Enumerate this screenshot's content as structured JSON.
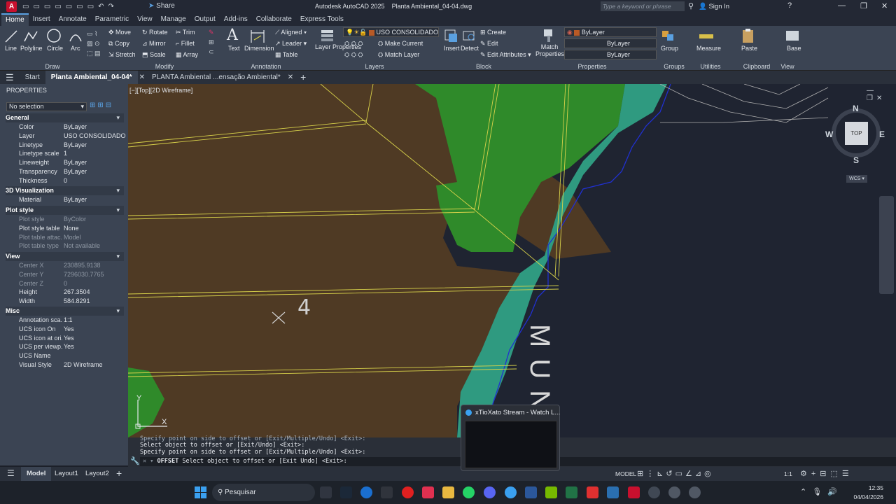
{
  "app": {
    "title": "Autodesk AutoCAD 2025",
    "drawing": "Planta Ambiental_04-04.dwg",
    "share": "Share",
    "search_placeholder": "Type a keyword or phrase",
    "signin": "Sign In"
  },
  "ribbon_tabs": [
    "Home",
    "Insert",
    "Annotate",
    "Parametric",
    "View",
    "Manage",
    "Output",
    "Add-ins",
    "Collaborate",
    "Express Tools"
  ],
  "ribbon": {
    "draw": {
      "line": "Line",
      "polyline": "Polyline",
      "circle": "Circle",
      "arc": "Arc",
      "title": "Draw"
    },
    "modify": {
      "move": "Move",
      "rotate": "Rotate",
      "trim": "Trim",
      "copy": "Copy",
      "mirror": "Mirror",
      "fillet": "Fillet",
      "stretch": "Stretch",
      "scale": "Scale",
      "array": "Array",
      "title": "Modify"
    },
    "annotation": {
      "text": "Text",
      "dimension": "Dimension",
      "aligned": "Aligned",
      "leader": "Leader",
      "table": "Table",
      "title": "Annotation"
    },
    "layers": {
      "layer_properties": "Layer Properties",
      "current_layer": "USO CONSOLIDADO",
      "make_current": "Make Current",
      "match_layer": "Match Layer",
      "title": "Layers"
    },
    "block": {
      "insert": "Insert",
      "detect": "Detect",
      "create": "Create",
      "edit": "Edit",
      "edit_attributes": "Edit Attributes",
      "title": "Block"
    },
    "properties": {
      "match": "Match Properties",
      "color": "ByLayer",
      "linetype": "ByLayer",
      "lineweight": "ByLayer",
      "title": "Properties"
    },
    "groups": {
      "group": "Group",
      "title": "Groups"
    },
    "utilities": {
      "measure": "Measure",
      "title": "Utilities"
    },
    "clipboard": {
      "paste": "Paste",
      "title": "Clipboard"
    },
    "view": {
      "base": "Base",
      "title": "View"
    }
  },
  "doc_tabs": {
    "start": "Start",
    "active": "Planta Ambiental_04-04*",
    "other": "PLANTA Ambiental ...ensação Ambiental*"
  },
  "properties_panel": {
    "title": "PROPERTIES",
    "selection": "No selection",
    "sections": {
      "general": "General",
      "viz3d": "3D Visualization",
      "plot": "Plot style",
      "view": "View",
      "misc": "Misc"
    },
    "general": [
      {
        "k": "Color",
        "v": "ByLayer"
      },
      {
        "k": "Layer",
        "v": "USO CONSOLIDADO"
      },
      {
        "k": "Linetype",
        "v": "ByLayer"
      },
      {
        "k": "Linetype scale",
        "v": "1"
      },
      {
        "k": "Lineweight",
        "v": "ByLayer"
      },
      {
        "k": "Transparency",
        "v": "ByLayer"
      },
      {
        "k": "Thickness",
        "v": "0"
      }
    ],
    "viz3d": [
      {
        "k": "Material",
        "v": "ByLayer"
      }
    ],
    "plot": [
      {
        "k": "Plot style",
        "v": "ByColor"
      },
      {
        "k": "Plot style table",
        "v": "None"
      },
      {
        "k": "Plot table attac...",
        "v": "Model"
      },
      {
        "k": "Plot table type",
        "v": "Not available"
      }
    ],
    "view": [
      {
        "k": "Center X",
        "v": "230895.9138"
      },
      {
        "k": "Center Y",
        "v": "7296030.7765"
      },
      {
        "k": "Center Z",
        "v": "0"
      },
      {
        "k": "Height",
        "v": "267.3504"
      },
      {
        "k": "Width",
        "v": "584.8291"
      }
    ],
    "misc": [
      {
        "k": "Annotation sca...",
        "v": "1:1"
      },
      {
        "k": "UCS icon On",
        "v": "Yes"
      },
      {
        "k": "UCS icon at ori...",
        "v": "Yes"
      },
      {
        "k": "UCS per viewp...",
        "v": "Yes"
      },
      {
        "k": "UCS Name",
        "v": ""
      },
      {
        "k": "Visual Style",
        "v": "2D Wireframe"
      }
    ]
  },
  "viewport": {
    "label": "[−][Top][2D Wireframe]",
    "marker": "4",
    "drawing_text": "MUNI"
  },
  "viewcube": {
    "n": "N",
    "s": "S",
    "e": "E",
    "w": "W",
    "face": "TOP",
    "wcs": "WCS"
  },
  "ucs": {
    "x": "X",
    "y": "Y"
  },
  "command": {
    "line0": "Specify point on side to offset or [Exit/Multiple/Undo] <Exit>:",
    "line1": "Select object to offset or [Exit/Undo] <Exit>:",
    "line2": "Specify point on side to offset or [Exit/Multiple/Undo] <Exit>:",
    "prompt_cmd": "OFFSET",
    "prompt_text": "Select object to offset or [Exit Undo] <Exit>:"
  },
  "status": {
    "model_tab": "Model",
    "layout1": "Layout1",
    "layout2": "Layout2",
    "model": "MODEL",
    "scale": "1:1"
  },
  "popup": {
    "title": "xTioXato Stream - Watch L..."
  },
  "taskbar": {
    "search": "Pesquisar",
    "time": "12:35",
    "date": "04/04/2026"
  },
  "colors": {
    "accent": "#5aa0e0",
    "brown": "#4f3a24",
    "green": "#2f8a2a",
    "teal": "#2f9a80",
    "yellow": "#d8d24a",
    "blue": "#2030d0"
  }
}
